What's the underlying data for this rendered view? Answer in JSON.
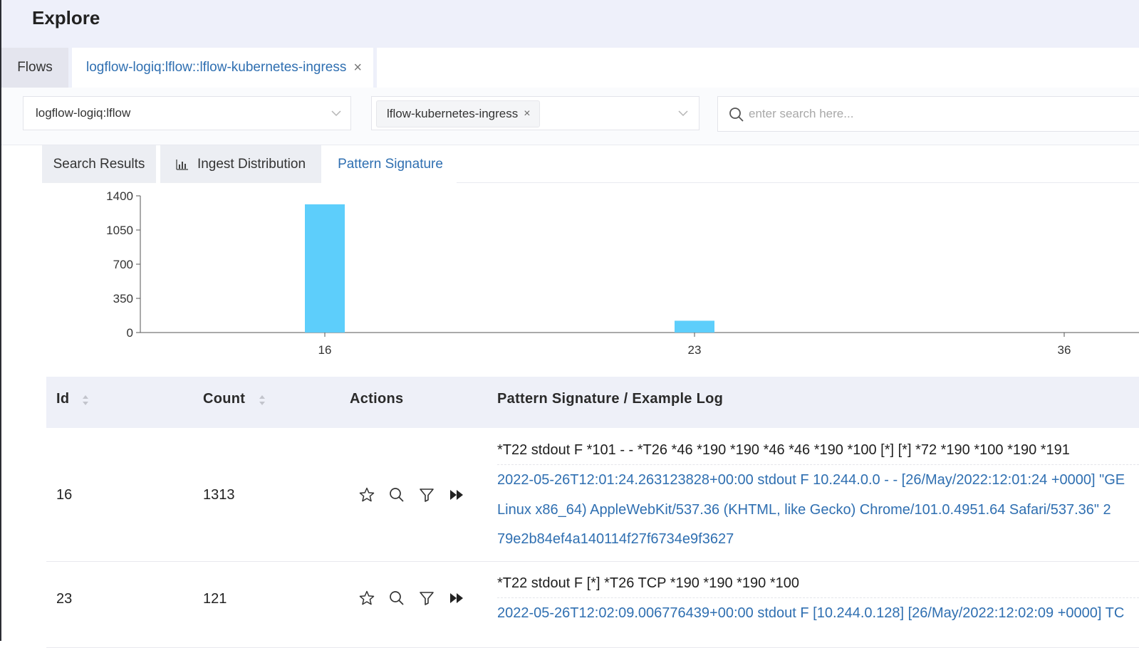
{
  "header": {
    "title": "Explore"
  },
  "tabs": {
    "flows_label": "Flows",
    "active_label": "logflow-logiq:lflow::lflow-kubernetes-ingress",
    "active_close": "×"
  },
  "filters": {
    "namespace_value": "logflow-logiq:lflow",
    "app_chip": "lflow-kubernetes-ingress",
    "app_chip_close": "×",
    "search_placeholder": "enter search here..."
  },
  "subtabs": {
    "search_results": "Search Results",
    "ingest_distribution": "Ingest Distribution",
    "pattern_signature": "Pattern Signature"
  },
  "colors": {
    "bar": "#5dcefb",
    "link": "#2f6fb1",
    "active_tab": "#2f6fb1"
  },
  "chart_data": {
    "type": "bar",
    "categories": [
      "16",
      "23",
      "36"
    ],
    "values": [
      1313,
      121,
      0
    ],
    "yticks": [
      "0",
      "350",
      "700",
      "1050",
      "1400"
    ],
    "ylim": [
      0,
      1400
    ],
    "xlabel": "",
    "ylabel": "",
    "grid": false
  },
  "table": {
    "headers": {
      "id": "Id",
      "count": "Count",
      "actions": "Actions",
      "signature": "Pattern Signature / Example Log"
    },
    "rows": [
      {
        "id": "16",
        "count": "1313",
        "signature": "*T22 stdout F *101 - - *T26 *46 *190 *190 *46 *46 *190 *100 [*] [*] *72 *190 *100 *190 *191",
        "log_lines": [
          "2022-05-26T12:01:24.263123828+00:00 stdout F 10.244.0.0 - - [26/May/2022:12:01:24 +0000] \"GE",
          "Linux x86_64) AppleWebKit/537.36 (KHTML, like Gecko) Chrome/101.0.4951.64 Safari/537.36\" 2",
          "79e2b84ef4a140114f27f6734e9f3627"
        ]
      },
      {
        "id": "23",
        "count": "121",
        "signature": "*T22 stdout F [*] *T26 TCP *190 *190 *190 *100",
        "log_lines": [
          "2022-05-26T12:02:09.006776439+00:00 stdout F [10.244.0.128] [26/May/2022:12:02:09 +0000] TC"
        ]
      }
    ]
  }
}
